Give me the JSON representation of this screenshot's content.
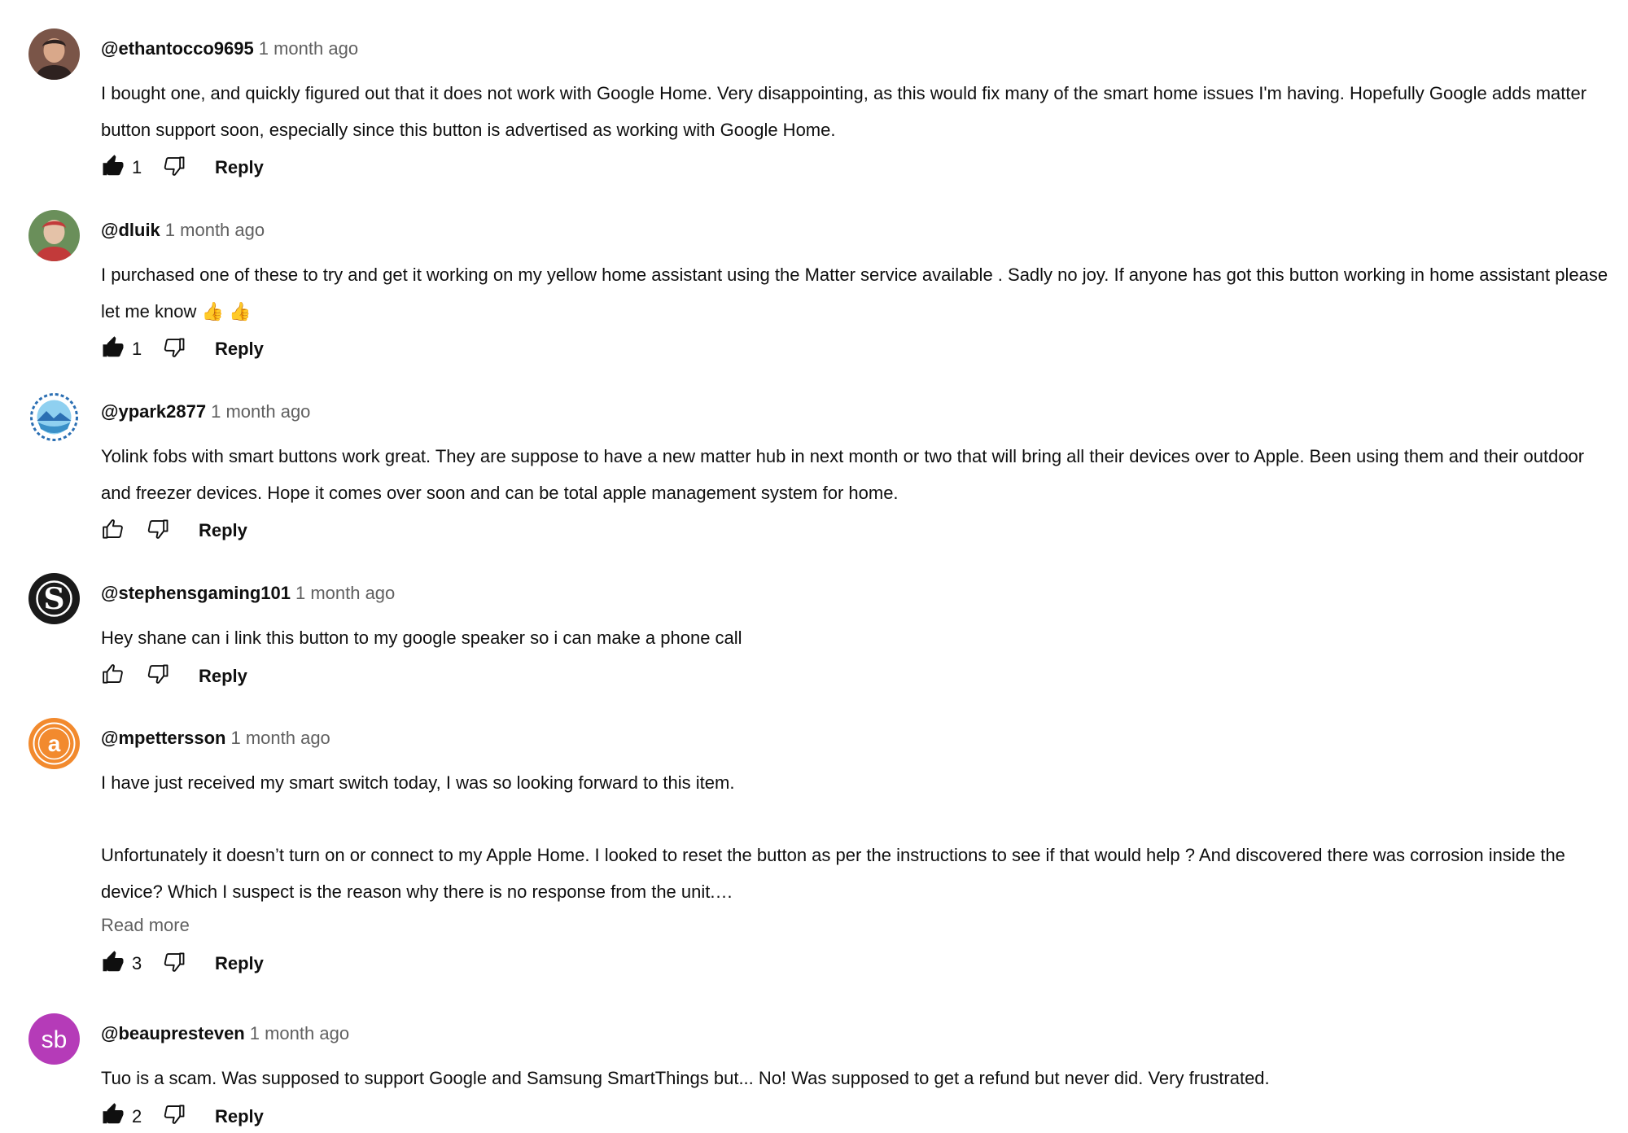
{
  "comments": [
    {
      "author": "@ethantocco9695",
      "time": "1 month ago",
      "paragraphs": [
        "I bought one, and quickly figured out that it does not work with Google Home. Very disappointing, as this would fix many of the smart home issues I'm having. Hopefully Google adds matter button support soon, especially since this button is advertised as working with Google Home."
      ],
      "likes": "1",
      "liked": true,
      "reply_label": "Reply",
      "avatar": {
        "kind": "photo",
        "colors": [
          "#7a5548",
          "#2e2220",
          "#d9a88a"
        ]
      }
    },
    {
      "author": "@dluik",
      "time": "1 month ago",
      "paragraphs": [
        "I purchased one of these to try and get it working on my yellow home assistant using the Matter service available . Sadly no joy. If anyone has got this button working in home assistant please let me know 👍 👍"
      ],
      "likes": "1",
      "liked": true,
      "reply_label": "Reply",
      "avatar": {
        "kind": "photo",
        "colors": [
          "#6a8f5a",
          "#c23a3a",
          "#e4c2a8"
        ]
      }
    },
    {
      "author": "@ypark2877",
      "time": "1 month ago",
      "paragraphs": [
        "Yolink fobs with smart buttons work great. They are suppose to have a new matter hub in next month or two that will bring all their devices over to Apple. Been using them and their outdoor and freezer devices. Hope it comes over soon and can be total apple management system for home."
      ],
      "likes": "",
      "liked": false,
      "reply_label": "Reply",
      "avatar": {
        "kind": "badge",
        "colors": [
          "#2b6fb3",
          "#8fd0f0",
          "#ffffff"
        ]
      }
    },
    {
      "author": "@stephensgaming101",
      "time": "1 month ago",
      "paragraphs": [
        "Hey shane can i link this button to my google speaker so i can make a phone call"
      ],
      "likes": "",
      "liked": false,
      "reply_label": "Reply",
      "avatar": {
        "kind": "letter-s",
        "colors": [
          "#1a1a1a",
          "#ffffff"
        ]
      }
    },
    {
      "author": "@mpettersson",
      "time": "1 month ago",
      "paragraphs": [
        "I have just received my smart switch today, I was so looking forward to this item.",
        "",
        "Unfortunately it doesn’t turn on or connect to my Apple Home. I looked to reset the button as per the instructions to see if that would help ? And discovered there was corrosion inside the device? Which I suspect is the reason why there is no response from the unit.…"
      ],
      "read_more": "Read more",
      "likes": "3",
      "liked": true,
      "reply_label": "Reply",
      "avatar": {
        "kind": "letter-a",
        "colors": [
          "#f28a2e",
          "#ffffff"
        ]
      }
    },
    {
      "author": "@beaupresteven",
      "time": "1 month ago",
      "paragraphs": [
        "Tuo is a scam. Was supposed to support Google and Samsung SmartThings but... No! Was supposed to get a refund but never did. Very frustrated."
      ],
      "likes": "2",
      "liked": true,
      "reply_label": "Reply",
      "avatar": {
        "kind": "initials",
        "initials": "sb",
        "colors": [
          "#b53bb8",
          "#ffffff"
        ]
      }
    }
  ]
}
